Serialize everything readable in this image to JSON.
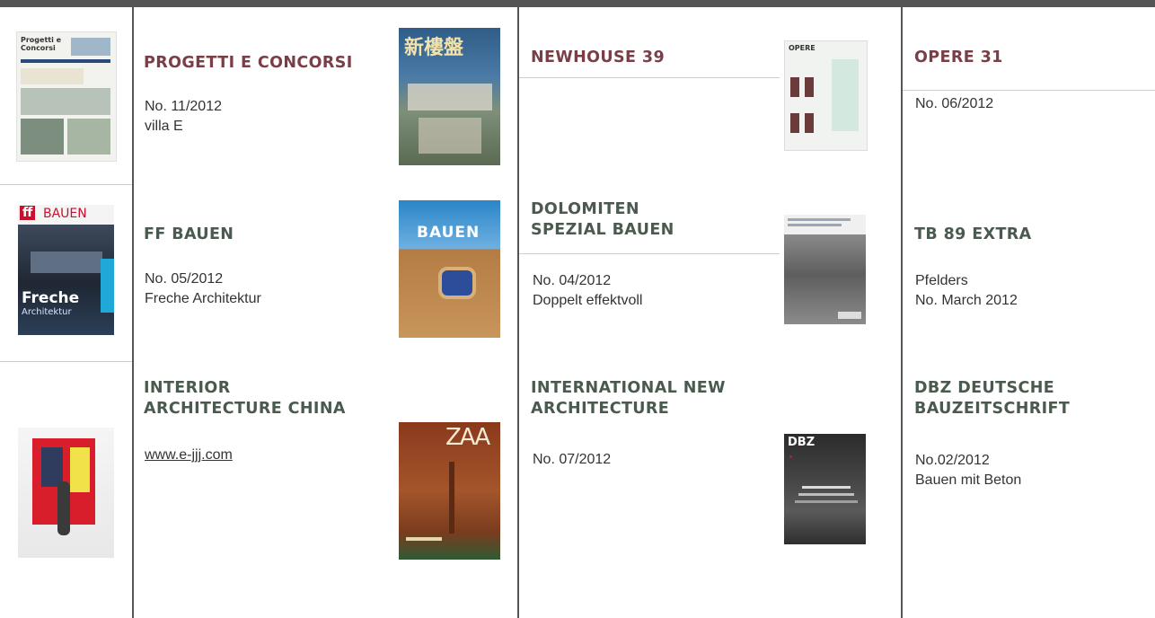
{
  "colors": {
    "topbar": "#555555",
    "accent": "#7a3e46",
    "divider": "#cfcfcf"
  },
  "entries": [
    {
      "title": "PROGETTI E CONCORSI",
      "line1": "No. 11/2012",
      "line2": "villa E"
    },
    {
      "title": "NEWHOUSE 39"
    },
    {
      "title": "OPERE 31",
      "line1": "No. 06/2012"
    },
    {
      "title": "FF BAUEN",
      "line1": "No. 05/2012",
      "line2": "Freche Architektur"
    },
    {
      "title": "DOLOMITEN\nSPEZIAL BAUEN",
      "line1": "No. 04/2012",
      "line2": "Doppelt effektvoll"
    },
    {
      "title": "TB 89 EXTRA",
      "line1": "Pfelders",
      "line2": "No. March 2012"
    },
    {
      "title": "INTERIOR\nARCHITECTURE CHINA",
      "link": "www.e-jjj.com"
    },
    {
      "title": "INTERNATIONAL NEW\nARCHITECTURE",
      "line1": "No. 07/2012"
    },
    {
      "title": "DBZ DEUTSCHE\nBAUZEITSCHRIFT",
      "line1": "No.02/2012",
      "line2": "Bauen mit Beton"
    }
  ],
  "covers": {
    "newhouse_masthead": "新樓盤",
    "ff_logo": "ff",
    "ff_word": "BAUEN",
    "ff_cover_word": "Freche",
    "ff_cover_word2": "Architektur",
    "bauen_word": "BAUEN",
    "dbz_word": "DBZ",
    "zaa_word": "ZAA",
    "progetti_word": "Progetti e Concorsi",
    "opere_word": "OPERE"
  }
}
